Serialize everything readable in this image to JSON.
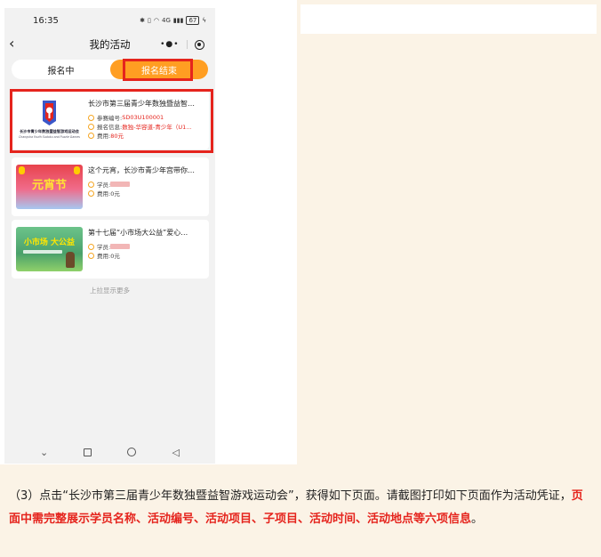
{
  "status_bar": {
    "time": "16:35",
    "signal": "4G",
    "battery": "67"
  },
  "nav": {
    "title": "我的活动",
    "more_icon": "more-dots-icon",
    "target_icon": "mini-program-target-icon"
  },
  "tabs": [
    {
      "label": "报名中",
      "active": false
    },
    {
      "label": "报名结束",
      "active": true
    }
  ],
  "cards": [
    {
      "title": "长沙市第三届青少年数独暨益智…",
      "thumb_caption": "长沙市青少年数独暨益智游戏运动会",
      "thumb_caption_en": "Changsha Youth Sudoku and Puzzle Games",
      "rows": [
        {
          "label": "参赛编号:",
          "value": "SD03U100001",
          "red": true
        },
        {
          "label": "报名信息:",
          "value": "数独-华容道-青少年（U1…",
          "red": true
        },
        {
          "label": "费用:",
          "value": "80元",
          "red": true
        }
      ]
    },
    {
      "title": "这个元宵，长沙市青少年宫带你…",
      "thumb_caption": "元宵节",
      "rows": [
        {
          "label": "学员:",
          "value": "",
          "red": false
        },
        {
          "label": "费用:",
          "value": "0元",
          "red": false
        }
      ]
    },
    {
      "title": "第十七届“小市场大公益”爱心…",
      "thumb_caption": "小市场 大公益",
      "rows": [
        {
          "label": "学员:",
          "value": "",
          "red": false
        },
        {
          "label": "费用:",
          "value": "0元",
          "red": false
        }
      ]
    }
  ],
  "load_more": "上拉显示更多",
  "instructions": {
    "part1": "（3）点击“长沙市第三届青少年数独暨益智游戏运动会”，获得如下页面。请截图打印如下页面作为活动凭证，",
    "part2": "页面中需完整展示学员名称、活动编号、活动项目、子项目、活动时间、活动地点等六项信息",
    "part3": "。"
  },
  "colors": {
    "accent": "#ff9e22",
    "highlight_box": "#e5241d",
    "emphasis": "#e5241d"
  }
}
